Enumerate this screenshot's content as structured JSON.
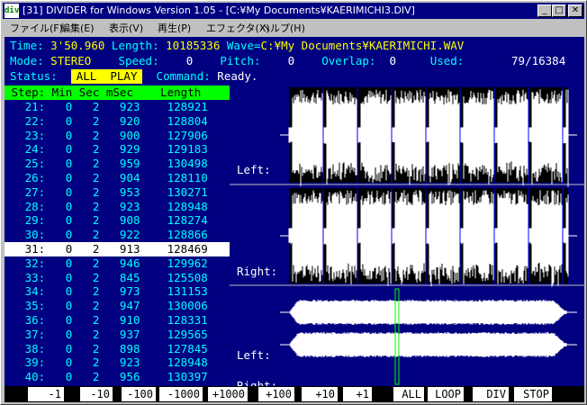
{
  "window": {
    "title": "[31] DIVIDER for Windows Version 1.05 - [C:¥My Documents¥KAERIMICHI3.DIV]",
    "app_icon": "div"
  },
  "menu": [
    "ファイル(F)",
    "編集(E)",
    "表示(V)",
    "再生(P)",
    "エフェクタ(X)",
    "ヘルプ(H)"
  ],
  "info": {
    "time_label": "Time:",
    "time": "3'50.960",
    "length_label": "Length:",
    "length": "10185336",
    "wave_label": "Wave=",
    "wave": "C:¥My Documents¥KAERIMICHI.WAV",
    "mode_label": "Mode:",
    "mode": "STEREO",
    "speed_label": "Speed:",
    "speed": "0",
    "pitch_label": "Pitch:",
    "pitch": "0",
    "overlap_label": "Overlap:",
    "overlap": "0",
    "used_label": "Used:",
    "used": "79/16384",
    "status_label": "Status:",
    "status": "ALL  PLAY",
    "command_label": "Command:",
    "command": "Ready."
  },
  "list": {
    "header": " Step: Min Sec mSec    Length",
    "rows": [
      {
        "step": "21:",
        "min": "0",
        "sec": "2",
        "msec": "923",
        "length": "128921"
      },
      {
        "step": "22:",
        "min": "0",
        "sec": "2",
        "msec": "920",
        "length": "128804"
      },
      {
        "step": "23:",
        "min": "0",
        "sec": "2",
        "msec": "900",
        "length": "127906"
      },
      {
        "step": "24:",
        "min": "0",
        "sec": "2",
        "msec": "929",
        "length": "129183"
      },
      {
        "step": "25:",
        "min": "0",
        "sec": "2",
        "msec": "959",
        "length": "130498"
      },
      {
        "step": "26:",
        "min": "0",
        "sec": "2",
        "msec": "904",
        "length": "128110"
      },
      {
        "step": "27:",
        "min": "0",
        "sec": "2",
        "msec": "953",
        "length": "130271"
      },
      {
        "step": "28:",
        "min": "0",
        "sec": "2",
        "msec": "923",
        "length": "128948"
      },
      {
        "step": "29:",
        "min": "0",
        "sec": "2",
        "msec": "908",
        "length": "128274"
      },
      {
        "step": "30:",
        "min": "0",
        "sec": "2",
        "msec": "922",
        "length": "128866"
      },
      {
        "step": "31:",
        "min": "0",
        "sec": "2",
        "msec": "913",
        "length": "128469"
      },
      {
        "step": "32:",
        "min": "0",
        "sec": "2",
        "msec": "946",
        "length": "129962"
      },
      {
        "step": "33:",
        "min": "0",
        "sec": "2",
        "msec": "845",
        "length": "125508"
      },
      {
        "step": "34:",
        "min": "0",
        "sec": "2",
        "msec": "973",
        "length": "131153"
      },
      {
        "step": "35:",
        "min": "0",
        "sec": "2",
        "msec": "947",
        "length": "130006"
      },
      {
        "step": "36:",
        "min": "0",
        "sec": "2",
        "msec": "910",
        "length": "128331"
      },
      {
        "step": "37:",
        "min": "0",
        "sec": "2",
        "msec": "937",
        "length": "129565"
      },
      {
        "step": "38:",
        "min": "0",
        "sec": "2",
        "msec": "898",
        "length": "127845"
      },
      {
        "step": "39:",
        "min": "0",
        "sec": "2",
        "msec": "923",
        "length": "128948"
      },
      {
        "step": "40:",
        "min": "0",
        "sec": "2",
        "msec": "956",
        "length": "130397"
      }
    ],
    "selected_index": 10
  },
  "waveform": {
    "top_left_label": "Left:",
    "top_right_label": "Right:",
    "overview_left_label": "Left:",
    "overview_right_label": "Right:"
  },
  "buttons": [
    "-1",
    "-10",
    "-100",
    "-1000",
    "+1000",
    "+100",
    "+10",
    "+1",
    "ALL",
    "LOOP",
    "DIV",
    "STOP"
  ],
  "colors": {
    "panel": "#000080",
    "text": "#00ffff",
    "highlight": "#ffff00",
    "header": "#00ff00",
    "selected_row": "#ffffff",
    "marker": "#00ff00"
  }
}
